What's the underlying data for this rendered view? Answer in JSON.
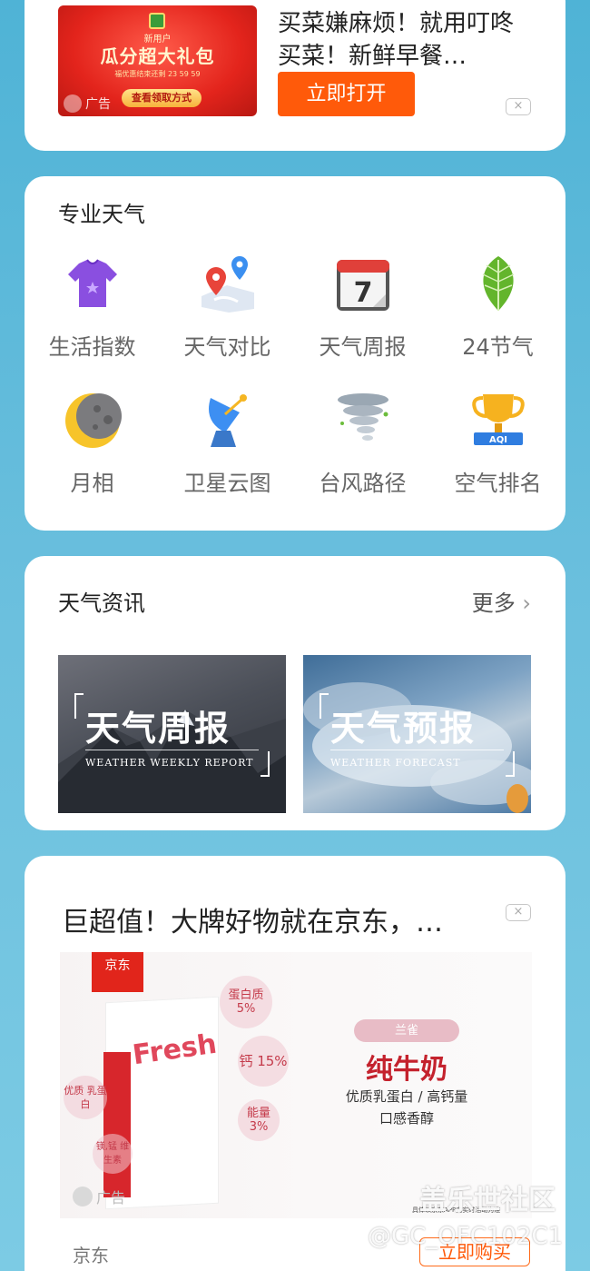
{
  "ad_top": {
    "banner": {
      "badge": "新用户",
      "headline": "瓜分超大礼包",
      "countdown_prefix": "福优惠结束还剩",
      "countdown": "23 59 59",
      "button": "查看领取方式",
      "ad_label": "广告"
    },
    "title": "买菜嫌麻烦！就用叮咚买菜！新鲜早餐…",
    "open_button": "立即打开",
    "close": "×"
  },
  "pro_weather": {
    "title": "专业天气",
    "tools": [
      {
        "label": "生活指数",
        "icon": "shirt-icon"
      },
      {
        "label": "天气对比",
        "icon": "map-pins-icon"
      },
      {
        "label": "天气周报",
        "icon": "calendar-icon",
        "badge": "7"
      },
      {
        "label": "24节气",
        "icon": "leaf-icon"
      },
      {
        "label": "月相",
        "icon": "moon-icon"
      },
      {
        "label": "卫星云图",
        "icon": "satellite-dish-icon"
      },
      {
        "label": "台风路径",
        "icon": "tornado-icon"
      },
      {
        "label": "空气排名",
        "icon": "trophy-icon",
        "badge": "AQI"
      }
    ]
  },
  "news": {
    "title": "天气资讯",
    "more": "更多",
    "items": [
      {
        "title": "天气周报",
        "subtitle": "WEATHER WEEKLY REPORT"
      },
      {
        "title": "天气预报",
        "subtitle": "WEATHER FORECAST"
      }
    ]
  },
  "ad_bottom": {
    "title": "巨超值！大牌好物就在京东，…",
    "close": "×",
    "product": {
      "jd_logo": "京东",
      "brand_tag": "兰雀",
      "name": "纯牛奶",
      "desc1": "优质乳蛋白 / 高钙量",
      "desc2": "口感香醇",
      "fresh": "Fresh",
      "bubbles": [
        "蛋白质 5%",
        "钙 15%",
        "能量 3%",
        "优质 乳蛋白",
        "镁,锰 维生素"
      ],
      "ad_label": "广告",
      "fine_print": "具体以京东APP内实时活动为准"
    },
    "brand": "京东",
    "buy_button": "立即购买"
  },
  "watermark": {
    "line1": "盖乐世社区",
    "line2": "@GC_OFC102C1"
  },
  "colors": {
    "background": "#5bb8d9",
    "accent_orange": "#ff5a0a",
    "jd_red": "#e1251b"
  }
}
